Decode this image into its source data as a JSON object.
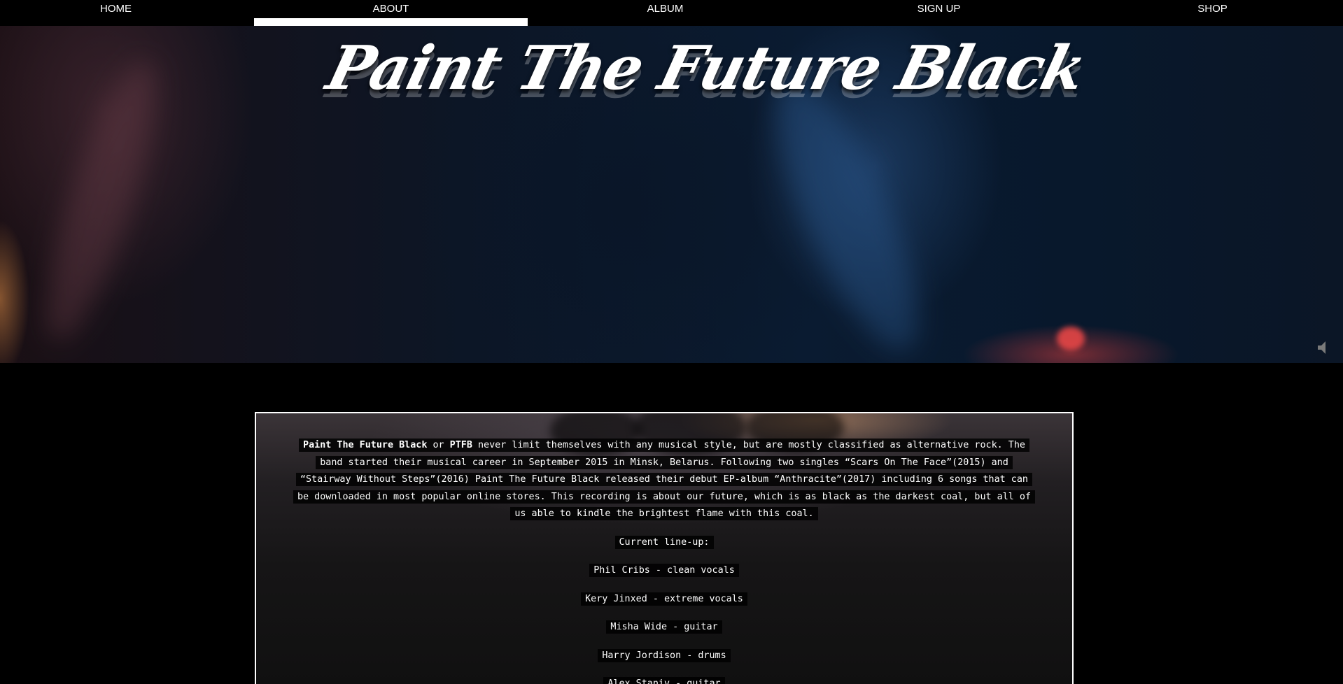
{
  "nav": {
    "items": [
      {
        "label": "HOME",
        "active": false
      },
      {
        "label": "ABOUT",
        "active": true
      },
      {
        "label": "ALBUM",
        "active": false
      },
      {
        "label": "SIGN UP",
        "active": false
      },
      {
        "label": "SHOP",
        "active": false
      }
    ]
  },
  "hero": {
    "logo_text": "Paint The Future Black",
    "mute_icon": "speaker-muted-icon"
  },
  "about": {
    "band_name": "Paint The Future Black",
    "or_text": " or ",
    "abbr": "PTFB",
    "intro_text": " never limit themselves with any musical style, but are mostly classified as alternative rock. The band started their musical career in September 2015 in Minsk, Belarus. Following two singles “Scars On The Face”(2015) and “Stairway Without Steps”(2016) Paint The Future Black released their debut EP-album “Anthracite”(2017) including 6 songs that can be downloaded in most popular online stores. This recording is about our future, which is as black as the darkest coal, but all of us able to kindle the brightest flame with this coal.",
    "lineup_heading": "Current line-up:",
    "lineup": [
      "Phil Cribs - clean vocals",
      "Kery Jinxed - extreme vocals",
      "Misha Wide - guitar",
      "Harry Jordison - drums",
      "Alex Staniv - guitar"
    ]
  }
}
